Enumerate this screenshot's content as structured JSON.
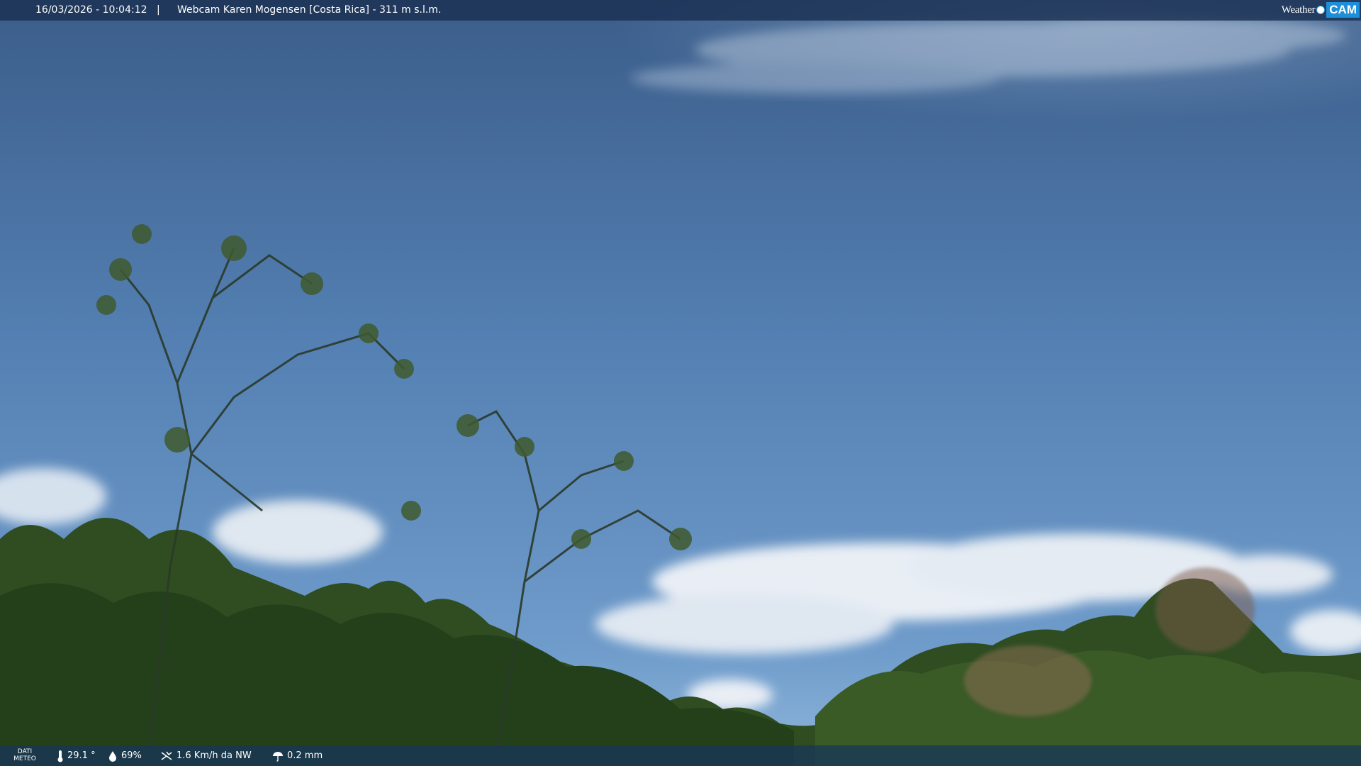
{
  "topbar": {
    "datetime": "16/03/2026 - 10:04:12",
    "separator": "|",
    "title": "Webcam Karen Mogensen [Costa Rica] - 311 m s.l.m."
  },
  "logo": {
    "weather": "Weather",
    "cam": "CAM"
  },
  "bottombar": {
    "label_line1": "DATI",
    "label_line2": "METEO",
    "temperature": "29.1 °",
    "humidity": "69%",
    "wind": "1.6 Km/h da NW",
    "rain": "0.2 mm"
  },
  "icons": {
    "temperature": "thermometer-icon",
    "humidity": "droplet-icon",
    "wind": "wind-icon",
    "rain": "rain-icon"
  },
  "colors": {
    "sky_top": "#3b5d8a",
    "sky_bottom": "#6f9ccb",
    "foliage": "#2e4a1f",
    "bar": "#1a3052",
    "logo_accent": "#1d8fd8"
  }
}
